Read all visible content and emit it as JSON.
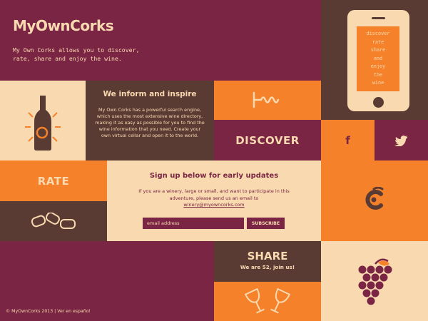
{
  "brand": {
    "logo_text": "MyOwnCorks",
    "tagline": "My Own Corks allows you to discover, rate, share and enjoy the wine."
  },
  "phone": {
    "lines": [
      "discover",
      "rate",
      "share",
      "and",
      "enjoy",
      "the",
      "wine"
    ]
  },
  "inform": {
    "title": "We inform and inspire",
    "body": "My Own Corks has a powerful search engine, which uses the most extensive wine directory, making it as easy as possible for you to find the wine information that you need. Create your own virtual cellar and open it to the world."
  },
  "tiles": {
    "discover": "DISCOVER",
    "rate": "RATE",
    "share": "SHARE",
    "share_sub": "We are 52, join us!"
  },
  "signup": {
    "title": "Sign up below for early updates",
    "body": "If you are a winery, large or small, and want to participate in this adventure, please send us an email to",
    "email": "winery@myowncorks.com",
    "input_placeholder": "email address",
    "button_label": "SUBSCRIBE"
  },
  "footer": {
    "copyright": "© MyOwnCorks 2013 | ",
    "language_link": "Ver en español"
  },
  "icons": {
    "facebook": "f",
    "twitter": "twitter-bird-icon",
    "bottle": "wine-bottle-icon",
    "corkscrew": "corkscrew-icon",
    "corks": "corks-icon",
    "logo_mark": "c-logo-icon",
    "glasses": "wine-glasses-icon",
    "grapes": "grapes-icon"
  },
  "colors": {
    "maroon": "#7a2543",
    "brown": "#5a3b33",
    "cream": "#f8d9b0",
    "orange": "#f5822a"
  }
}
